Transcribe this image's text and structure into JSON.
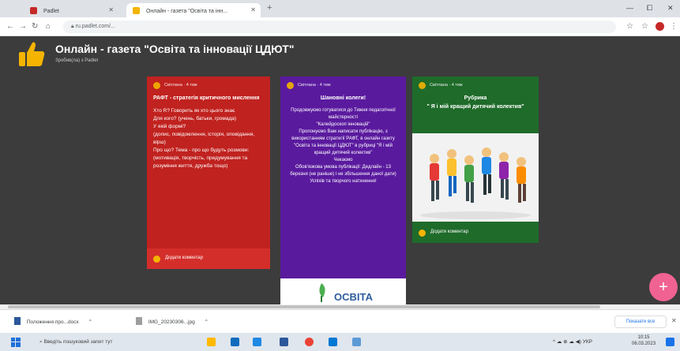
{
  "browser": {
    "tabs": [
      {
        "label": "Padlet",
        "favicon_color": "#c62828"
      },
      {
        "label": "Онлайн - газета \"Освіта та інн...",
        "favicon_color": "#f4b400"
      }
    ],
    "url": "ru.padlet.com/...",
    "window_controls": [
      "—",
      "⧠",
      "✕"
    ]
  },
  "wall": {
    "title": "Онлайн - газета \"Освіта та інновації ЦДЮТ\"",
    "subtitle": "Зробив(ла) з Padlet"
  },
  "posts": [
    {
      "author": "Світлана · 4 тиж",
      "color": "#c0221f",
      "footer_color": "#d42e2b",
      "title": "РАФТ - стратегія критичного мислення",
      "body": "Хто R? Говорить як хто цього знає\nДля кого? (учень, батьки, громада)\nУ якій формі?\n(допис, повідомлення, історія, оповідання, вірш)\nПро що? Тема - про що будуть розмови: (мотивація, творчість, придумування та розуміння життя, дружба тощо)",
      "footer": "Додати коментар"
    },
    {
      "author": "Світлана · 4 тиж",
      "color": "#5a1a9e",
      "footer_color": "#5a1a9e",
      "title": "Шановні колеги!",
      "body": "Продовжуємо готуватися до Тижня педагогічної майстерності\n\"Калейдоскоп інновацій\"\nПропонуємо Вам написати публікацію, з використанням стратегії РАФТ, в онлайн газету \"Освіта та інновації ЦДЮТ\" в рубриці \"Я і мій кращий дитячий колектив\"\nЧекаємо\nОбов'язкова умова публікації: Дедлайн - 13 березня (не раніше) і не збільшення даної дати) Успіхів та творчого натхнення!",
      "footer": "",
      "banner_text": "ОСВІТА"
    },
    {
      "author": "Світлана · 4 тиж",
      "color": "#1f6b2a",
      "footer_color": "#1f6b2a",
      "title": "Рубрика\n\" Я і мій кращий дитячий колектив\"",
      "body": "",
      "footer": "Додати коментар"
    }
  ],
  "fab_label": "+",
  "downloads": [
    {
      "name": "Положення про...docx"
    },
    {
      "name": "IMG_20230306...jpg"
    }
  ],
  "downloads_show_all": "Показати все",
  "taskbar": {
    "search_placeholder": "Введіть пошуковий запит тут",
    "tray_text": "^ ☁ ⊕ ☁ ◀) УКР",
    "clock_time": "10:15",
    "clock_date": "06.03.2023"
  }
}
